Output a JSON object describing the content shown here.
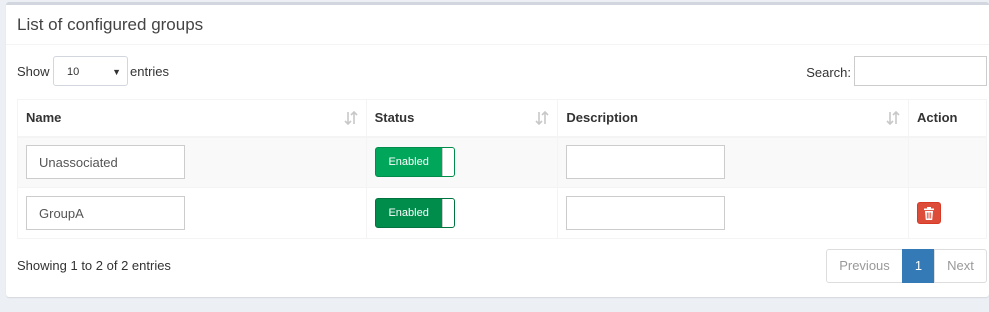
{
  "header": {
    "title": "List of configured groups"
  },
  "controls": {
    "show_label": "Show",
    "page_size": "10",
    "entries_label": "entries",
    "search_label": "Search:",
    "search_value": ""
  },
  "table": {
    "columns": [
      "Name",
      "Status",
      "Description",
      "Action"
    ],
    "rows": [
      {
        "name": "Unassociated",
        "status": "Enabled",
        "description": "",
        "deletable": false
      },
      {
        "name": "GroupA",
        "status": "Enabled",
        "description": "",
        "deletable": true
      }
    ]
  },
  "footer": {
    "info": "Showing 1 to 2 of 2 entries",
    "pagination": {
      "previous": "Previous",
      "current": "1",
      "next": "Next"
    }
  },
  "colors": {
    "toggle_enabled": "#00a65a",
    "delete_button": "#dd4b39",
    "active_page": "#337ab7"
  }
}
